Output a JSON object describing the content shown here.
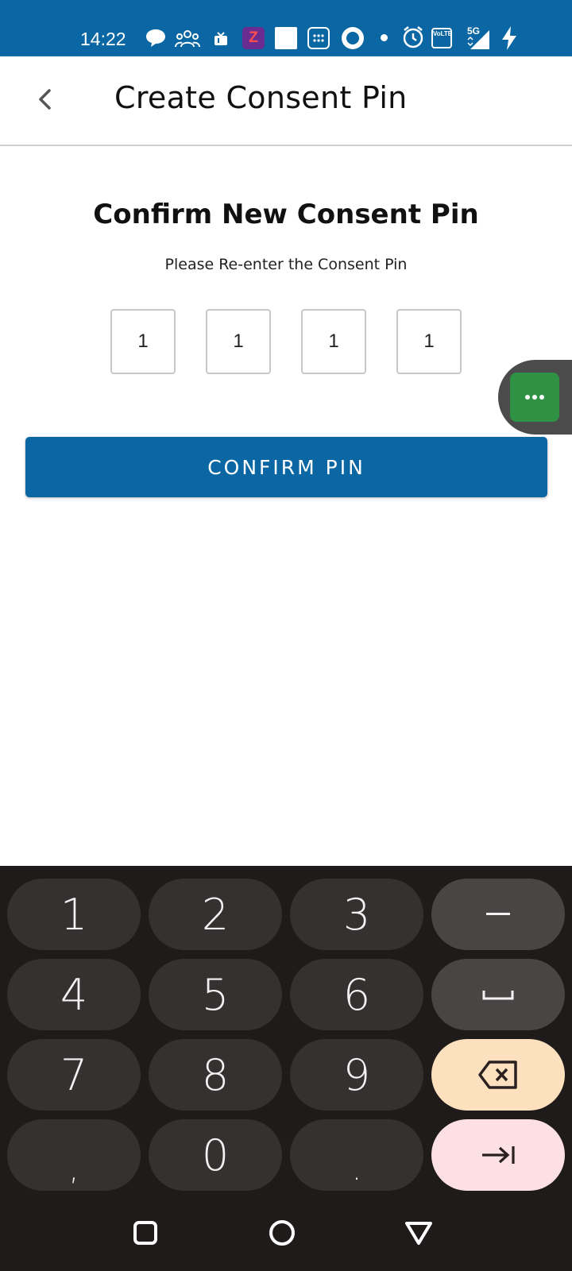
{
  "status_bar": {
    "time": "14:22",
    "network": "5G",
    "volte": "VoLTE",
    "app_badge": "Z"
  },
  "app_bar": {
    "title": "Create Consent Pin"
  },
  "main": {
    "heading": "Confirm New Consent Pin",
    "subheading": "Please Re-enter the Consent Pin",
    "pin_digits": [
      "1",
      "1",
      "1",
      "1"
    ],
    "confirm_label": "CONFIRM PIN"
  },
  "keyboard": {
    "rows": [
      [
        "1",
        "2",
        "3"
      ],
      [
        "4",
        "5",
        "6"
      ],
      [
        "7",
        "8",
        "9"
      ],
      [
        ",",
        "0",
        "."
      ]
    ],
    "colors": {
      "background": "#1f1b1b",
      "key": "#363131",
      "backspace": "#fde0bd",
      "tab": "#fde0e4"
    }
  },
  "colors": {
    "primary": "#0a67a3",
    "chat_head": "#2f9143"
  },
  "icons": {
    "back": "chevron-left-icon",
    "chat": "more-horizontal-icon",
    "minus": "minus-icon",
    "space": "space-bar-icon",
    "backspace": "backspace-icon",
    "tab": "tab-arrow-icon",
    "nav_recents": "square-icon",
    "nav_home": "circle-icon",
    "nav_back": "triangle-icon"
  }
}
